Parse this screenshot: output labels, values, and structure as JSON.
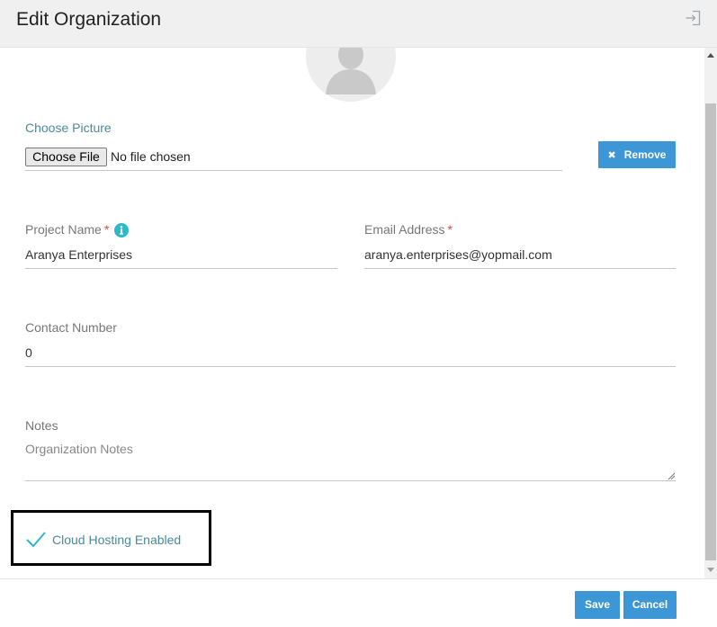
{
  "header": {
    "title": "Edit Organization",
    "exit_icon": "sign-out-icon"
  },
  "picture": {
    "label": "Choose Picture",
    "choose_file_label": "Choose File",
    "file_status": "No file chosen",
    "remove_label": "Remove",
    "remove_icon": "times-icon"
  },
  "form": {
    "project_name": {
      "label": "Project Name",
      "required_marker": "*",
      "info_icon": "info-icon",
      "value": "Aranya Enterprises"
    },
    "email": {
      "label": "Email Address",
      "required_marker": "*",
      "value": "aranya.enterprises@yopmail.com"
    },
    "contact": {
      "label": "Contact Number",
      "value": "0"
    },
    "notes": {
      "label": "Notes",
      "placeholder": "Organization Notes",
      "value": ""
    }
  },
  "cloud_hosting": {
    "label": "Cloud Hosting Enabled",
    "checked": true
  },
  "footer": {
    "save_label": "Save",
    "cancel_label": "Cancel"
  },
  "colors": {
    "accent_teal": "#4a8a99",
    "button_blue": "#3d97d6",
    "check_teal": "#2bb8c9",
    "required_red": "#e04a3a"
  }
}
